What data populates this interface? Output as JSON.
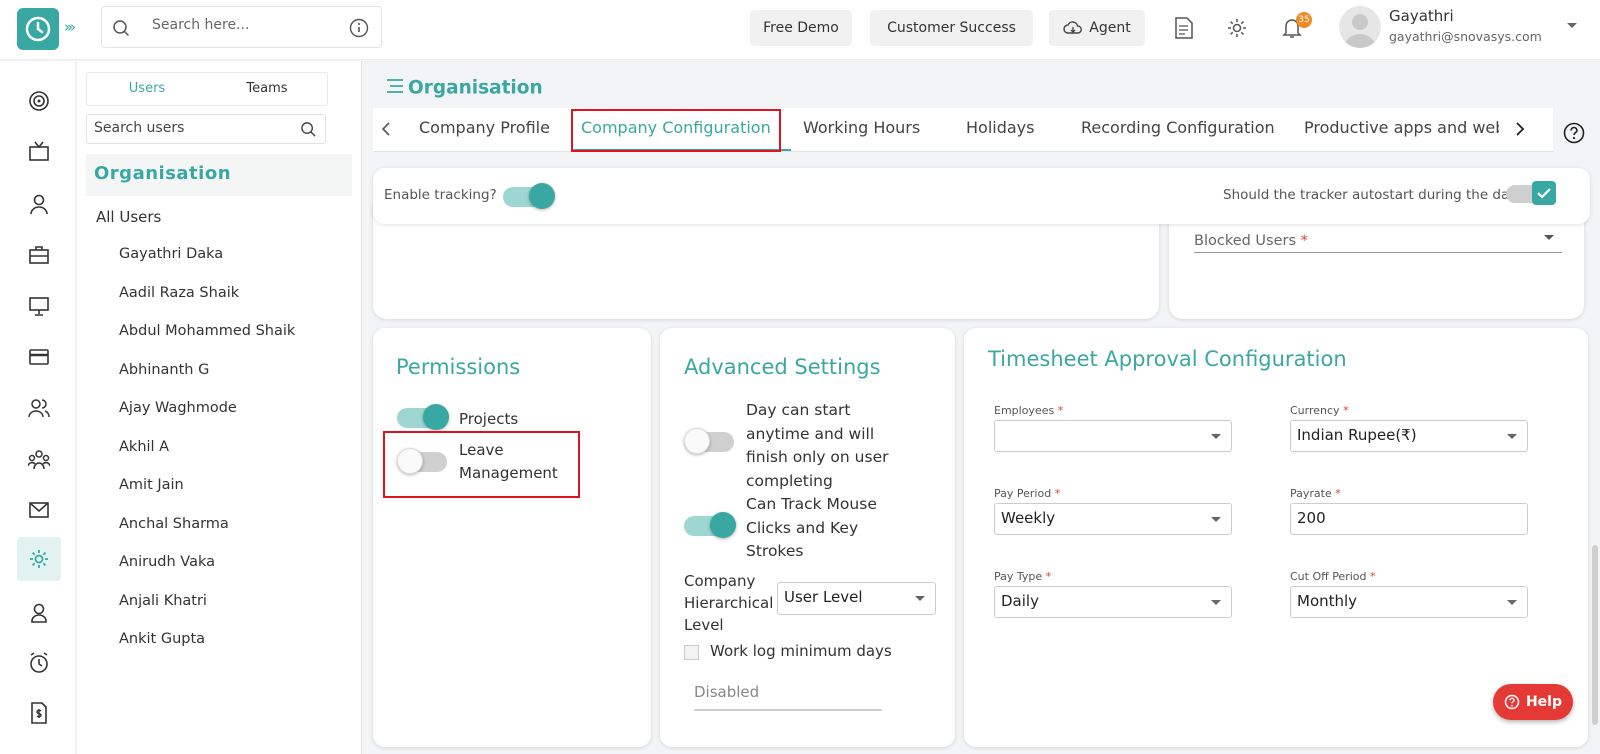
{
  "header": {
    "search_placeholder": "Search here...",
    "free_demo": "Free Demo",
    "customer_success": "Customer Success",
    "agent": "Agent",
    "notification_count": "35",
    "user_name": "Gayathri",
    "user_email": "gayathri@snovasys.com"
  },
  "user_panel": {
    "tabs": [
      "Users",
      "Teams"
    ],
    "active_tab": "Users",
    "search_placeholder": "Search users",
    "org_title": "Organisation",
    "all_users": "All Users",
    "users": [
      "Gayathri Daka",
      "Aadil Raza Shaik",
      "Abdul Mohammed Shaik",
      "Abhinanth G",
      "Ajay Waghmode",
      "Akhil A",
      "Amit Jain",
      "Anchal Sharma",
      "Anirudh Vaka",
      "Anjali Khatri",
      "Ankit Gupta"
    ]
  },
  "page": {
    "title": "Organisation",
    "tabs": [
      "Company Profile",
      "Company Configuration",
      "Working Hours",
      "Holidays",
      "Recording Configuration",
      "Productive apps and web"
    ],
    "active_tab": "Company Configuration"
  },
  "tracker": {
    "enable_label": "Enable tracking?",
    "enable_on": true,
    "autostart_label": "Should the tracker autostart during the day",
    "autostart_checked": true
  },
  "blocked_users": {
    "label": "Blocked Users",
    "required_mark": "*"
  },
  "permissions": {
    "title": "Permissions",
    "items": [
      {
        "label": "Projects",
        "on": true
      },
      {
        "label_line1": "Leave",
        "label_line2": "Management",
        "on": false
      }
    ]
  },
  "advanced": {
    "title": "Advanced Settings",
    "day_start_lines": [
      "Day can start",
      "anytime and will",
      "finish only on user",
      "completing"
    ],
    "day_start_on": false,
    "mouse_lines": [
      "Can Track Mouse",
      "Clicks and Key",
      "Strokes"
    ],
    "mouse_on": true,
    "hier_lines": [
      "Company",
      "Hierarchical",
      "Level"
    ],
    "hier_value": "User Level",
    "worklog_label": "Work log minimum days",
    "worklog_value": "Disabled"
  },
  "timesheet": {
    "title": "Timesheet Approval Configuration",
    "employees_label": "Employees",
    "employees_value": "",
    "currency_label": "Currency",
    "currency_value": "Indian Rupee(₹)",
    "pay_period_label": "Pay Period",
    "pay_period_value": "Weekly",
    "payrate_label": "Payrate",
    "payrate_value": "200",
    "pay_type_label": "Pay Type",
    "pay_type_value": "Daily",
    "cutoff_label": "Cut Off Period",
    "cutoff_value": "Monthly",
    "required_mark": "*"
  },
  "help": "Help",
  "colors": {
    "accent": "#3aa8a2",
    "highlight": "#e0141e",
    "help": "#e53935"
  }
}
